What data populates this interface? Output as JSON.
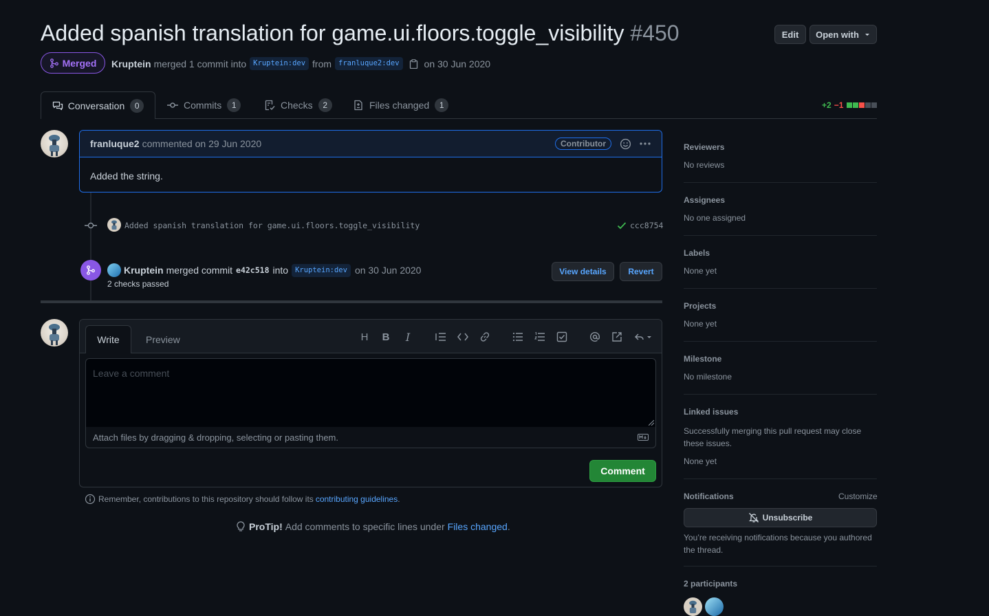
{
  "pr": {
    "title": "Added spanish translation for game.ui.floors.toggle_visibility",
    "number": "#450",
    "state_label": "Merged",
    "merger": "Kruptein",
    "merged_text": "merged 1 commit into",
    "base_branch": "Kruptein:dev",
    "from_text": "from",
    "head_branch": "franluque2:dev",
    "merged_date": "on 30 Jun 2020",
    "edit_label": "Edit",
    "open_with_label": "Open with"
  },
  "tabs": [
    {
      "label": "Conversation",
      "count": "0"
    },
    {
      "label": "Commits",
      "count": "1"
    },
    {
      "label": "Checks",
      "count": "2"
    },
    {
      "label": "Files changed",
      "count": "1"
    }
  ],
  "diffstat": {
    "additions": "+2",
    "deletions": "−1"
  },
  "comment": {
    "author": "franluque2",
    "action": "commented on 29 Jun 2020",
    "badge": "Contributor",
    "body": "Added the string."
  },
  "commit": {
    "message": "Added spanish translation for game.ui.floors.toggle_visibility",
    "sha": "ccc8754"
  },
  "merge_event": {
    "actor": "Kruptein",
    "text": "merged commit",
    "sha": "e42c518",
    "into": "into",
    "branch": "Kruptein:dev",
    "date": "on 30 Jun 2020",
    "checks": "2 checks passed",
    "view_details_label": "View details",
    "revert_label": "Revert"
  },
  "editor": {
    "write_tab": "Write",
    "preview_tab": "Preview",
    "placeholder": "Leave a comment",
    "attach_text": "Attach files by dragging & dropping, selecting or pasting them.",
    "comment_button": "Comment"
  },
  "footer": {
    "remember_text": "Remember, contributions to this repository should follow its",
    "guidelines_link": "contributing guidelines",
    "period": ".",
    "protip_label": "ProTip!",
    "protip_text": "Add comments to specific lines under",
    "protip_link": "Files changed",
    "protip_period": "."
  },
  "sidebar": {
    "reviewers_heading": "Reviewers",
    "reviewers_value": "No reviews",
    "assignees_heading": "Assignees",
    "assignees_value": "No one assigned",
    "labels_heading": "Labels",
    "labels_value": "None yet",
    "projects_heading": "Projects",
    "projects_value": "None yet",
    "milestone_heading": "Milestone",
    "milestone_value": "No milestone",
    "linked_heading": "Linked issues",
    "linked_desc": "Successfully merging this pull request may close these issues.",
    "linked_value": "None yet",
    "notifications_heading": "Notifications",
    "customize_label": "Customize",
    "unsubscribe_label": "Unsubscribe",
    "notif_reason": "You’re receiving notifications because you authored the thread.",
    "participants_heading": "2 participants"
  },
  "colors": {
    "background": "#0d1117",
    "merged_purple": "#a371f7",
    "link_blue": "#58a6ff",
    "success_green": "#238636",
    "diff_add": "#3fb950",
    "diff_del": "#f85149"
  }
}
